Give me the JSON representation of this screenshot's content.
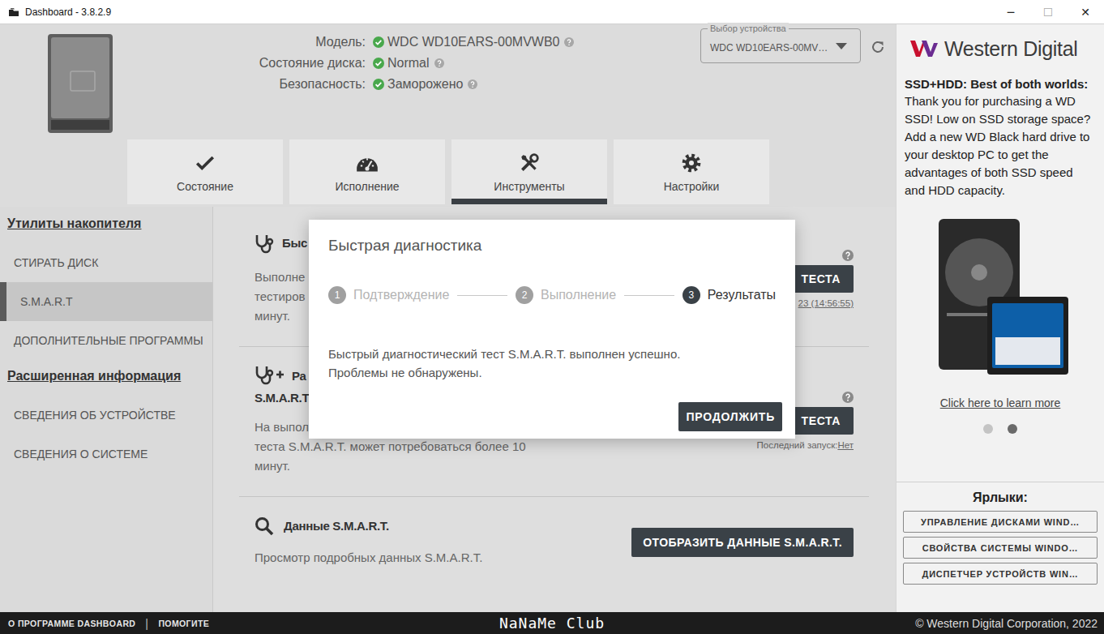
{
  "window": {
    "title": "Dashboard - 3.8.2.9",
    "controls": [
      "─",
      "☐",
      "✕"
    ]
  },
  "drive": {
    "fields": [
      {
        "label": "Модель:",
        "value": "WDC WD10EARS-00MVWB0"
      },
      {
        "label": "Состояние диска:",
        "value": "Normal"
      },
      {
        "label": "Безопасность:",
        "value": "Заморожено"
      }
    ]
  },
  "device_select": {
    "label": "Выбор устройства",
    "value": "WDC WD10EARS-00MV…"
  },
  "tabs": [
    {
      "label": "Состояние",
      "selected": false
    },
    {
      "label": "Исполнение",
      "selected": false
    },
    {
      "label": "Инструменты",
      "selected": true
    },
    {
      "label": "Настройки",
      "selected": false
    }
  ],
  "sidebar": {
    "sections": [
      {
        "title": "Утилиты накопителя",
        "items": [
          {
            "label": "СТИРАТЬ ДИСК",
            "selected": false
          },
          {
            "label": "S.M.A.R.T",
            "selected": true
          },
          {
            "label": "ДОПОЛНИТЕЛЬНЫЕ ПРОГРАММЫ",
            "selected": false
          }
        ]
      },
      {
        "title": "Расширенная информация",
        "items": [
          {
            "label": "СВЕДЕНИЯ ОБ УСТРОЙСТВЕ",
            "selected": false
          },
          {
            "label": "СВЕДЕНИЯ О СИСТЕМЕ",
            "selected": false
          }
        ]
      }
    ]
  },
  "tests": [
    {
      "title": [
        "Быс"
      ],
      "lines": [
        "Выполне",
        "тестиров",
        "минут."
      ],
      "button": "ТЕСТА",
      "last_run": "23 (14:56:55)"
    },
    {
      "title": [
        "Ра",
        "S.M.A.R.T"
      ],
      "lines": [
        "На выпол",
        "теста S.M.A.R.T. может потребоваться более 10",
        "минут."
      ],
      "button": "ТЕСТА",
      "last_run_label": "Последний запуск:",
      "last_run": "Нет"
    }
  ],
  "smart_data": {
    "title": "Данные S.M.A.R.T.",
    "description": "Просмотр подробных данных S.M.A.R.T.",
    "button": "ОТОБРАЗИТЬ ДАННЫЕ S.M.A.R.T."
  },
  "dialog": {
    "title": "Быстрая диагностика",
    "steps": [
      {
        "number": "1",
        "label": "Подтверждение",
        "selected": false
      },
      {
        "number": "2",
        "label": "Выполнение",
        "selected": false
      },
      {
        "number": "3",
        "label": "Результаты",
        "selected": true
      }
    ],
    "message": [
      "Быстрый диагностический тест S.M.A.R.T. выполнен успешно.",
      "Проблемы не обнаружены."
    ],
    "button": "ПРОДОЛЖИТЬ"
  },
  "ad": {
    "logo": "Western Digital",
    "heading": "SSD+HDD: Best of both worlds:",
    "text": "Thank you for purchasing a WD SSD! Low on SSD storage space? Add a new WD Black hard drive to your desktop PC to get the advantages of both SSD speed and HDD capacity.",
    "link": "Click here to learn more",
    "dots": [
      {
        "selected": false
      },
      {
        "selected": true
      }
    ]
  },
  "shortcuts": {
    "title": "Ярлыки:",
    "items": [
      "УПРАВЛЕНИЕ ДИСКАМИ WIND…",
      "СВОЙСТВА СИСТЕМЫ WINDO…",
      "ДИСПЕТЧЕР УСТРОЙСТВ WIN…"
    ]
  },
  "status_bar": {
    "links": [
      "О ПРОГРАММЕ DASHBOARD",
      "ПОМОГИТЕ"
    ],
    "separator": "|",
    "watermark": "NaNaMe Club",
    "copyright": "© Western Digital Corporation, 2022"
  }
}
